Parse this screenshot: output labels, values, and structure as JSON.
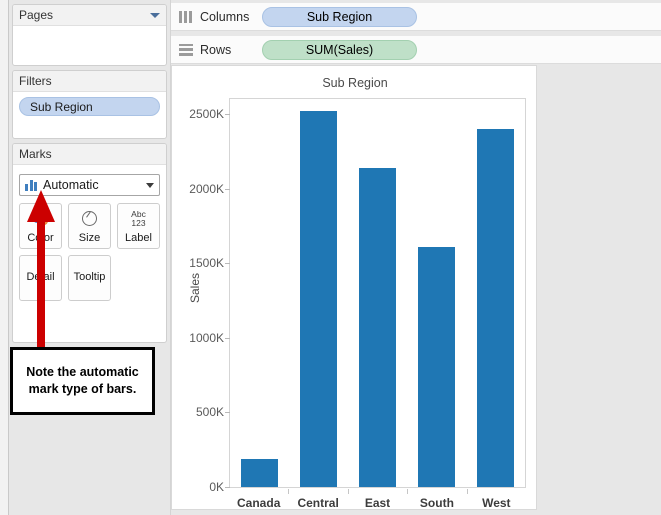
{
  "left_panel": {
    "pages_card": {
      "title": "Pages",
      "chevron_icon": "chevron-down-icon"
    },
    "filters_card": {
      "title": "Filters",
      "pills": [
        "Sub Region"
      ]
    },
    "marks_card": {
      "title": "Marks",
      "dropdown_value": "Automatic",
      "dropdown_icon": "bar-chart-icon",
      "chevron_icon": "chevron-down-icon",
      "buttons": [
        {
          "label": "Color",
          "icon": "color-palette-icon"
        },
        {
          "label": "Size",
          "icon": "size-circle-icon"
        },
        {
          "label": "Label",
          "icon": "abc-123-icon",
          "icon_top": "Abc",
          "icon_bottom": "123"
        },
        {
          "label": "Detail",
          "icon": ""
        },
        {
          "label": "Tooltip",
          "icon": ""
        }
      ]
    }
  },
  "annotation": {
    "text": "Note the automatic mark type of bars.",
    "arrow_icon": "up-arrow-icon",
    "arrow_color": "#cc0000"
  },
  "shelves": [
    {
      "name": "Columns",
      "icon": "columns-icon",
      "pill": "Sub Region",
      "pill_color": "#c3d5ef"
    },
    {
      "name": "Rows",
      "icon": "rows-icon",
      "pill": "SUM(Sales)",
      "pill_color": "#bfe0c8"
    }
  ],
  "chart_data": {
    "type": "bar",
    "title": "Sub Region",
    "categories": [
      "Canada",
      "Central",
      "East",
      "South",
      "West"
    ],
    "values": [
      185,
      2520,
      2135,
      1610,
      2400
    ],
    "value_unit": "K",
    "xlabel": "",
    "ylabel": "Sales",
    "ylim": [
      0,
      2600
    ],
    "yticks": [
      0,
      500,
      1000,
      1500,
      2000,
      2500
    ],
    "ytick_labels": [
      "0K",
      "500K",
      "1000K",
      "1500K",
      "2000K",
      "2500K"
    ],
    "grid": false,
    "legend": "none",
    "bar_color": "#1f77b4"
  }
}
